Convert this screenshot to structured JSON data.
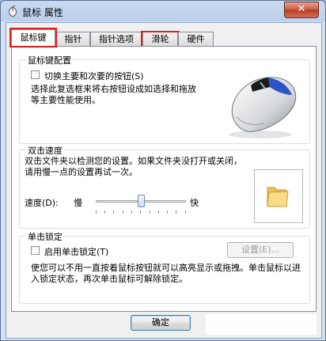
{
  "window": {
    "title": "鼠标 属性",
    "close_glyph": "✕"
  },
  "tabs": [
    {
      "label": "鼠标键",
      "active": true,
      "highlighted": true
    },
    {
      "label": "指针",
      "active": false,
      "highlighted": false
    },
    {
      "label": "指针选项",
      "active": false,
      "highlighted": false
    },
    {
      "label": "滑轮",
      "active": false,
      "highlighted": true
    },
    {
      "label": "硬件",
      "active": false,
      "highlighted": false
    }
  ],
  "button_config": {
    "title": "鼠标键配置",
    "switch_label": "切换主要和次要的按钮(S)",
    "switch_checked": false,
    "description": "选择此复选框来将右按钮设成如选择和拖放等主要性能使用。"
  },
  "double_click": {
    "title": "双击速度",
    "description": "双击文件夹以检测您的设置。如果文件夹没打开或关闭，请用慢一点的设置再试一次。",
    "speed_label": "速度(D):",
    "slow_label": "慢",
    "fast_label": "快",
    "speed_level": 0.5
  },
  "click_lock": {
    "title": "单击锁定",
    "enable_label": "启用单击锁定(T)",
    "enable_checked": false,
    "settings_button": "设置(E)...",
    "description": "使您可以不用一直按着鼠标按钮就可以高亮显示或拖拽。单击鼠标以进入锁定状态，再次单击鼠标可解除锁定。"
  },
  "footer": {
    "ok_label": "确定"
  },
  "icons": {
    "app": "mouse-icon",
    "mouse_image": "mouse-illustration",
    "folder": "folder-icon"
  },
  "colors": {
    "highlight_box": "#e02020",
    "accent": "#3c7fb1"
  }
}
